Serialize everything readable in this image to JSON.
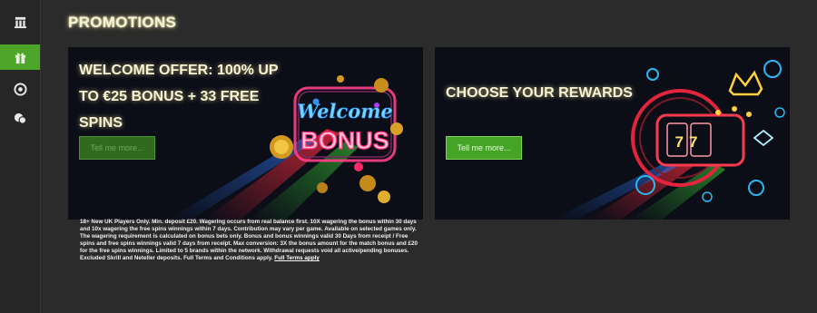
{
  "sidebar": {
    "items": [
      {
        "icon": "casino-icon",
        "active": false
      },
      {
        "icon": "gift-icon",
        "active": true
      },
      {
        "icon": "chip-icon",
        "active": false
      },
      {
        "icon": "chat-icon",
        "active": false
      }
    ],
    "active_color": "#4da52a"
  },
  "page": {
    "title": "PROMOTIONS"
  },
  "promotions": [
    {
      "title": "WELCOME OFFER: 100% UP TO €25 BONUS + 33 FREE SPINS",
      "button_label": "Tell me more...",
      "art_text_1": "Welcome",
      "art_text_2": "BONUS"
    },
    {
      "title": "CHOOSE YOUR REWARDS",
      "button_label": "Tell me more...",
      "art_text_1": "77"
    }
  ],
  "terms": {
    "text": "18+ New UK Players Only. Min. deposit £20. Wagering occurs from real balance first. 10X wagering the bonus within 30 days and 10x wagering the free spins winnings within 7 days. Contribution may vary per game. Available on selected games only. The wagering requirement is calculated on bonus bets only. Bonus and bonus winnings valid 30 Days from receipt / Free spins and free spins winnings valid 7 days from receipt. Max conversion: 3X the bonus amount for the match bonus and £20 for the free spins winnings. Limited to 5 brands within the network. Withdrawal requests void all active/pending bonuses. Excluded Skrill and Neteller deposits. Full Terms and Conditions apply.",
    "link_label": "Full Terms apply"
  },
  "colors": {
    "accent_green": "#4da52a",
    "background": "#2b2b2b",
    "card_background": "#0b0d17"
  }
}
